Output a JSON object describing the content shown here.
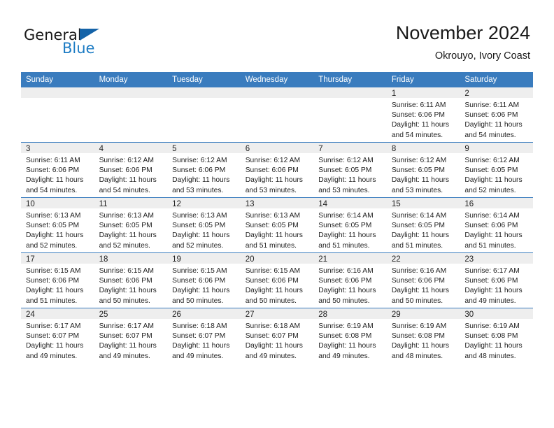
{
  "brand": {
    "name_part1": "General",
    "name_part2": "Blue"
  },
  "header": {
    "title": "November 2024",
    "subtitle": "Okrouyo, Ivory Coast"
  },
  "colors": {
    "header_blue": "#3a7cbe",
    "brand_blue": "#1d7cc4",
    "daynum_gray": "#eeeeee"
  },
  "weekdays": [
    "Sunday",
    "Monday",
    "Tuesday",
    "Wednesday",
    "Thursday",
    "Friday",
    "Saturday"
  ],
  "weeks": [
    [
      {
        "day": "",
        "sunrise": "",
        "sunset": "",
        "daylight_line1": "",
        "daylight_line2": ""
      },
      {
        "day": "",
        "sunrise": "",
        "sunset": "",
        "daylight_line1": "",
        "daylight_line2": ""
      },
      {
        "day": "",
        "sunrise": "",
        "sunset": "",
        "daylight_line1": "",
        "daylight_line2": ""
      },
      {
        "day": "",
        "sunrise": "",
        "sunset": "",
        "daylight_line1": "",
        "daylight_line2": ""
      },
      {
        "day": "",
        "sunrise": "",
        "sunset": "",
        "daylight_line1": "",
        "daylight_line2": ""
      },
      {
        "day": "1",
        "sunrise": "Sunrise: 6:11 AM",
        "sunset": "Sunset: 6:06 PM",
        "daylight_line1": "Daylight: 11 hours",
        "daylight_line2": "and 54 minutes."
      },
      {
        "day": "2",
        "sunrise": "Sunrise: 6:11 AM",
        "sunset": "Sunset: 6:06 PM",
        "daylight_line1": "Daylight: 11 hours",
        "daylight_line2": "and 54 minutes."
      }
    ],
    [
      {
        "day": "3",
        "sunrise": "Sunrise: 6:11 AM",
        "sunset": "Sunset: 6:06 PM",
        "daylight_line1": "Daylight: 11 hours",
        "daylight_line2": "and 54 minutes."
      },
      {
        "day": "4",
        "sunrise": "Sunrise: 6:12 AM",
        "sunset": "Sunset: 6:06 PM",
        "daylight_line1": "Daylight: 11 hours",
        "daylight_line2": "and 54 minutes."
      },
      {
        "day": "5",
        "sunrise": "Sunrise: 6:12 AM",
        "sunset": "Sunset: 6:06 PM",
        "daylight_line1": "Daylight: 11 hours",
        "daylight_line2": "and 53 minutes."
      },
      {
        "day": "6",
        "sunrise": "Sunrise: 6:12 AM",
        "sunset": "Sunset: 6:06 PM",
        "daylight_line1": "Daylight: 11 hours",
        "daylight_line2": "and 53 minutes."
      },
      {
        "day": "7",
        "sunrise": "Sunrise: 6:12 AM",
        "sunset": "Sunset: 6:05 PM",
        "daylight_line1": "Daylight: 11 hours",
        "daylight_line2": "and 53 minutes."
      },
      {
        "day": "8",
        "sunrise": "Sunrise: 6:12 AM",
        "sunset": "Sunset: 6:05 PM",
        "daylight_line1": "Daylight: 11 hours",
        "daylight_line2": "and 53 minutes."
      },
      {
        "day": "9",
        "sunrise": "Sunrise: 6:12 AM",
        "sunset": "Sunset: 6:05 PM",
        "daylight_line1": "Daylight: 11 hours",
        "daylight_line2": "and 52 minutes."
      }
    ],
    [
      {
        "day": "10",
        "sunrise": "Sunrise: 6:13 AM",
        "sunset": "Sunset: 6:05 PM",
        "daylight_line1": "Daylight: 11 hours",
        "daylight_line2": "and 52 minutes."
      },
      {
        "day": "11",
        "sunrise": "Sunrise: 6:13 AM",
        "sunset": "Sunset: 6:05 PM",
        "daylight_line1": "Daylight: 11 hours",
        "daylight_line2": "and 52 minutes."
      },
      {
        "day": "12",
        "sunrise": "Sunrise: 6:13 AM",
        "sunset": "Sunset: 6:05 PM",
        "daylight_line1": "Daylight: 11 hours",
        "daylight_line2": "and 52 minutes."
      },
      {
        "day": "13",
        "sunrise": "Sunrise: 6:13 AM",
        "sunset": "Sunset: 6:05 PM",
        "daylight_line1": "Daylight: 11 hours",
        "daylight_line2": "and 51 minutes."
      },
      {
        "day": "14",
        "sunrise": "Sunrise: 6:14 AM",
        "sunset": "Sunset: 6:05 PM",
        "daylight_line1": "Daylight: 11 hours",
        "daylight_line2": "and 51 minutes."
      },
      {
        "day": "15",
        "sunrise": "Sunrise: 6:14 AM",
        "sunset": "Sunset: 6:05 PM",
        "daylight_line1": "Daylight: 11 hours",
        "daylight_line2": "and 51 minutes."
      },
      {
        "day": "16",
        "sunrise": "Sunrise: 6:14 AM",
        "sunset": "Sunset: 6:06 PM",
        "daylight_line1": "Daylight: 11 hours",
        "daylight_line2": "and 51 minutes."
      }
    ],
    [
      {
        "day": "17",
        "sunrise": "Sunrise: 6:15 AM",
        "sunset": "Sunset: 6:06 PM",
        "daylight_line1": "Daylight: 11 hours",
        "daylight_line2": "and 51 minutes."
      },
      {
        "day": "18",
        "sunrise": "Sunrise: 6:15 AM",
        "sunset": "Sunset: 6:06 PM",
        "daylight_line1": "Daylight: 11 hours",
        "daylight_line2": "and 50 minutes."
      },
      {
        "day": "19",
        "sunrise": "Sunrise: 6:15 AM",
        "sunset": "Sunset: 6:06 PM",
        "daylight_line1": "Daylight: 11 hours",
        "daylight_line2": "and 50 minutes."
      },
      {
        "day": "20",
        "sunrise": "Sunrise: 6:15 AM",
        "sunset": "Sunset: 6:06 PM",
        "daylight_line1": "Daylight: 11 hours",
        "daylight_line2": "and 50 minutes."
      },
      {
        "day": "21",
        "sunrise": "Sunrise: 6:16 AM",
        "sunset": "Sunset: 6:06 PM",
        "daylight_line1": "Daylight: 11 hours",
        "daylight_line2": "and 50 minutes."
      },
      {
        "day": "22",
        "sunrise": "Sunrise: 6:16 AM",
        "sunset": "Sunset: 6:06 PM",
        "daylight_line1": "Daylight: 11 hours",
        "daylight_line2": "and 50 minutes."
      },
      {
        "day": "23",
        "sunrise": "Sunrise: 6:17 AM",
        "sunset": "Sunset: 6:06 PM",
        "daylight_line1": "Daylight: 11 hours",
        "daylight_line2": "and 49 minutes."
      }
    ],
    [
      {
        "day": "24",
        "sunrise": "Sunrise: 6:17 AM",
        "sunset": "Sunset: 6:07 PM",
        "daylight_line1": "Daylight: 11 hours",
        "daylight_line2": "and 49 minutes."
      },
      {
        "day": "25",
        "sunrise": "Sunrise: 6:17 AM",
        "sunset": "Sunset: 6:07 PM",
        "daylight_line1": "Daylight: 11 hours",
        "daylight_line2": "and 49 minutes."
      },
      {
        "day": "26",
        "sunrise": "Sunrise: 6:18 AM",
        "sunset": "Sunset: 6:07 PM",
        "daylight_line1": "Daylight: 11 hours",
        "daylight_line2": "and 49 minutes."
      },
      {
        "day": "27",
        "sunrise": "Sunrise: 6:18 AM",
        "sunset": "Sunset: 6:07 PM",
        "daylight_line1": "Daylight: 11 hours",
        "daylight_line2": "and 49 minutes."
      },
      {
        "day": "28",
        "sunrise": "Sunrise: 6:19 AM",
        "sunset": "Sunset: 6:08 PM",
        "daylight_line1": "Daylight: 11 hours",
        "daylight_line2": "and 49 minutes."
      },
      {
        "day": "29",
        "sunrise": "Sunrise: 6:19 AM",
        "sunset": "Sunset: 6:08 PM",
        "daylight_line1": "Daylight: 11 hours",
        "daylight_line2": "and 48 minutes."
      },
      {
        "day": "30",
        "sunrise": "Sunrise: 6:19 AM",
        "sunset": "Sunset: 6:08 PM",
        "daylight_line1": "Daylight: 11 hours",
        "daylight_line2": "and 48 minutes."
      }
    ]
  ]
}
